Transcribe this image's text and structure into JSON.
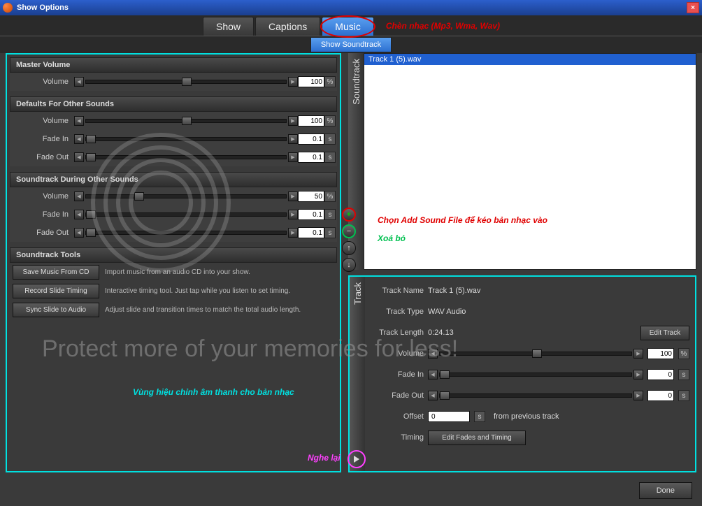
{
  "window": {
    "title": "Show Options",
    "close": "×"
  },
  "tabs": {
    "show": "Show",
    "captions": "Captions",
    "music": "Music"
  },
  "subtab": "Show Soundtrack",
  "annotations": {
    "top": "Chèn nhạc (Mp3, Wma, Wav)",
    "add": "Chọn Add Sound File để kéo bản nhạc vào",
    "remove": "Xoá bỏ",
    "zone": "Vùng hiệu chỉnh âm thanh cho bản nhạc",
    "play": "Nghe lại"
  },
  "master": {
    "header": "Master Volume",
    "volume_lbl": "Volume",
    "volume": "100",
    "unit": "%"
  },
  "defaults": {
    "header": "Defaults For Other Sounds",
    "volume_lbl": "Volume",
    "volume": "100",
    "pct": "%",
    "fadein_lbl": "Fade In",
    "fadein": "0.1",
    "fadeout_lbl": "Fade Out",
    "fadeout": "0.1",
    "s": "s"
  },
  "during": {
    "header": "Soundtrack During Other Sounds",
    "volume_lbl": "Volume",
    "volume": "50",
    "pct": "%",
    "fadein_lbl": "Fade In",
    "fadein": "0.1",
    "fadeout_lbl": "Fade Out",
    "fadeout": "0.1",
    "s": "s"
  },
  "tools": {
    "header": "Soundtrack Tools",
    "cd_btn": "Save Music From CD",
    "cd_desc": "Import music from an audio CD into your show.",
    "rec_btn": "Record Slide Timing",
    "rec_desc": "Interactive timing tool. Just tap while you listen to set timing.",
    "sync_btn": "Sync Slide to Audio",
    "sync_desc": "Adjust slide and transition times to match the total audio length."
  },
  "soundtrack": {
    "label": "Soundtrack",
    "track": "Track 1 (5).wav"
  },
  "trackpanel": {
    "label": "Track",
    "name_lbl": "Track Name",
    "name": "Track 1 (5).wav",
    "type_lbl": "Track Type",
    "type": "WAV Audio",
    "len_lbl": "Track Length",
    "len": "0:24.13",
    "edit": "Edit Track",
    "volume_lbl": "Volume",
    "volume": "100",
    "pct": "%",
    "fadein_lbl": "Fade In",
    "fadein": "0",
    "s": "s",
    "fadeout_lbl": "Fade Out",
    "fadeout": "0",
    "offset_lbl": "Offset",
    "offset": "0",
    "offset_desc": "from previous track",
    "timing_lbl": "Timing",
    "timing_btn": "Edit Fades and Timing"
  },
  "done": "Done",
  "watermark": "Protect more of your memories for less!"
}
